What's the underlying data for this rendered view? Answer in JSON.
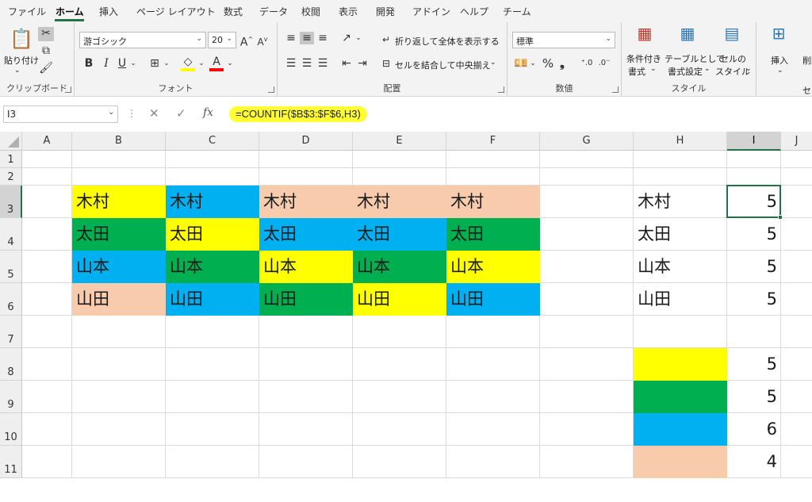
{
  "tabs": [
    "ファイル",
    "ホーム",
    "挿入",
    "ページ レイアウト",
    "数式",
    "データ",
    "校閲",
    "表示",
    "開発",
    "アドイン",
    "ヘルプ",
    "チーム"
  ],
  "ribbon": {
    "clipboard": {
      "label": "クリップボード",
      "paste": "貼り付け"
    },
    "font": {
      "label": "フォント",
      "name": "游ゴシック",
      "size": "20",
      "bold": "B",
      "italic": "I",
      "underline": "U",
      "font_color_letter": "A"
    },
    "alignment": {
      "label": "配置",
      "wrap": "折り返して全体を表示する",
      "merge": "セルを結合して中央揃え"
    },
    "number": {
      "label": "数値",
      "format": "標準",
      "percent": "%",
      "comma": "❟"
    },
    "styles": {
      "label": "スタイル",
      "conditional_1": "条件付き",
      "conditional_2": "書式",
      "table_1": "テーブルとして",
      "table_2": "書式設定",
      "cell_1": "セルの",
      "cell_2": "スタイル"
    },
    "cells": {
      "insert": "挿入",
      "delete": "削除",
      "label_partial": "セ"
    }
  },
  "formula_bar": {
    "name_box": "I3",
    "fx": "fx",
    "formula": "=COUNTIF($B$3:$F$6,H3)"
  },
  "colors": {
    "yellow": "#ffff00",
    "green": "#00b050",
    "blue": "#00b0f0",
    "peach": "#f8cbad",
    "accent": "#217346"
  },
  "sheet": {
    "columns": [
      "A",
      "B",
      "C",
      "D",
      "E",
      "F",
      "G",
      "H",
      "I",
      "J"
    ],
    "rows": [
      "1",
      "2",
      "3",
      "4",
      "5",
      "6",
      "7",
      "8",
      "9",
      "10",
      "11"
    ],
    "names": [
      [
        "木村",
        "木村",
        "木村",
        "木村",
        "木村"
      ],
      [
        "太田",
        "太田",
        "太田",
        "太田",
        "太田"
      ],
      [
        "山本",
        "山本",
        "山本",
        "山本",
        "山本"
      ],
      [
        "山田",
        "山田",
        "山田",
        "山田",
        "山田"
      ]
    ],
    "lookup": [
      "木村",
      "太田",
      "山本",
      "山田"
    ],
    "counts": [
      "5",
      "5",
      "5",
      "5"
    ],
    "color_counts": [
      "5",
      "5",
      "6",
      "4"
    ]
  }
}
